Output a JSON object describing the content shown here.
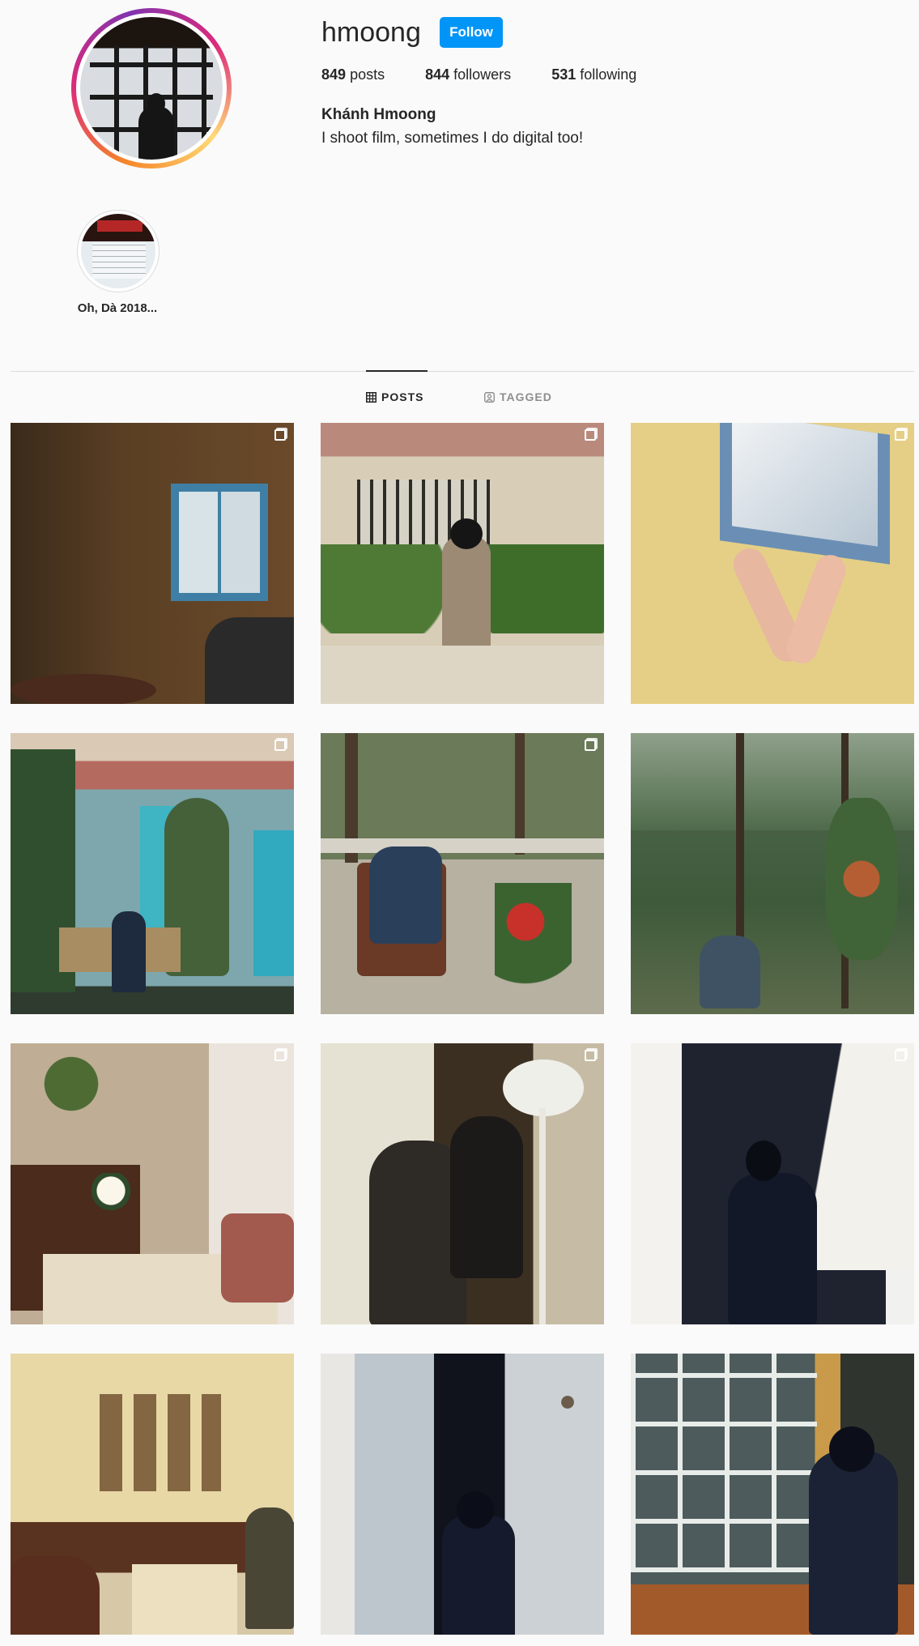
{
  "profile": {
    "username": "hmoong",
    "follow_label": "Follow",
    "stats": {
      "posts_count": "849",
      "posts_label": "posts",
      "followers_count": "844",
      "followers_label": "followers",
      "following_count": "531",
      "following_label": "following"
    },
    "full_name": "Khánh Hmoong",
    "bio": "I shoot film, sometimes I do digital too!"
  },
  "highlights": [
    {
      "label": "Oh, Dà 2018..."
    }
  ],
  "tabs": [
    {
      "label": "POSTS",
      "active": true,
      "icon": "grid-icon"
    },
    {
      "label": "TAGGED",
      "active": false,
      "icon": "tag-user-icon"
    }
  ],
  "posts": [
    {
      "id": 1,
      "multiple": true,
      "scene": "interior with blue window"
    },
    {
      "id": 2,
      "multiple": true,
      "scene": "woman in coat by ivy window with bicycle"
    },
    {
      "id": 3,
      "multiple": true,
      "scene": "arms hanging from open window on yellow wall"
    },
    {
      "id": 4,
      "multiple": true,
      "scene": "woman seated before turquoise house"
    },
    {
      "id": 5,
      "multiple": true,
      "scene": "woman in chair on garden terrace"
    },
    {
      "id": 6,
      "multiple": false,
      "scene": "woman sitting among pine trees"
    },
    {
      "id": 7,
      "multiple": true,
      "scene": "room with flowers on table"
    },
    {
      "id": 8,
      "multiple": true,
      "scene": "two figures by window with plants"
    },
    {
      "id": 9,
      "multiple": true,
      "scene": "woman sitting in doorway with curtain"
    },
    {
      "id": 10,
      "multiple": false,
      "scene": "room with framed pictures and flowers"
    },
    {
      "id": 11,
      "multiple": false,
      "scene": "woman in dark dress by french doors"
    },
    {
      "id": 12,
      "multiple": false,
      "scene": "woman holding glass by window panes"
    }
  ],
  "colors": {
    "accent": "#0095f6",
    "background": "#fafafa",
    "text": "#262626",
    "muted": "#8e8e8e"
  }
}
